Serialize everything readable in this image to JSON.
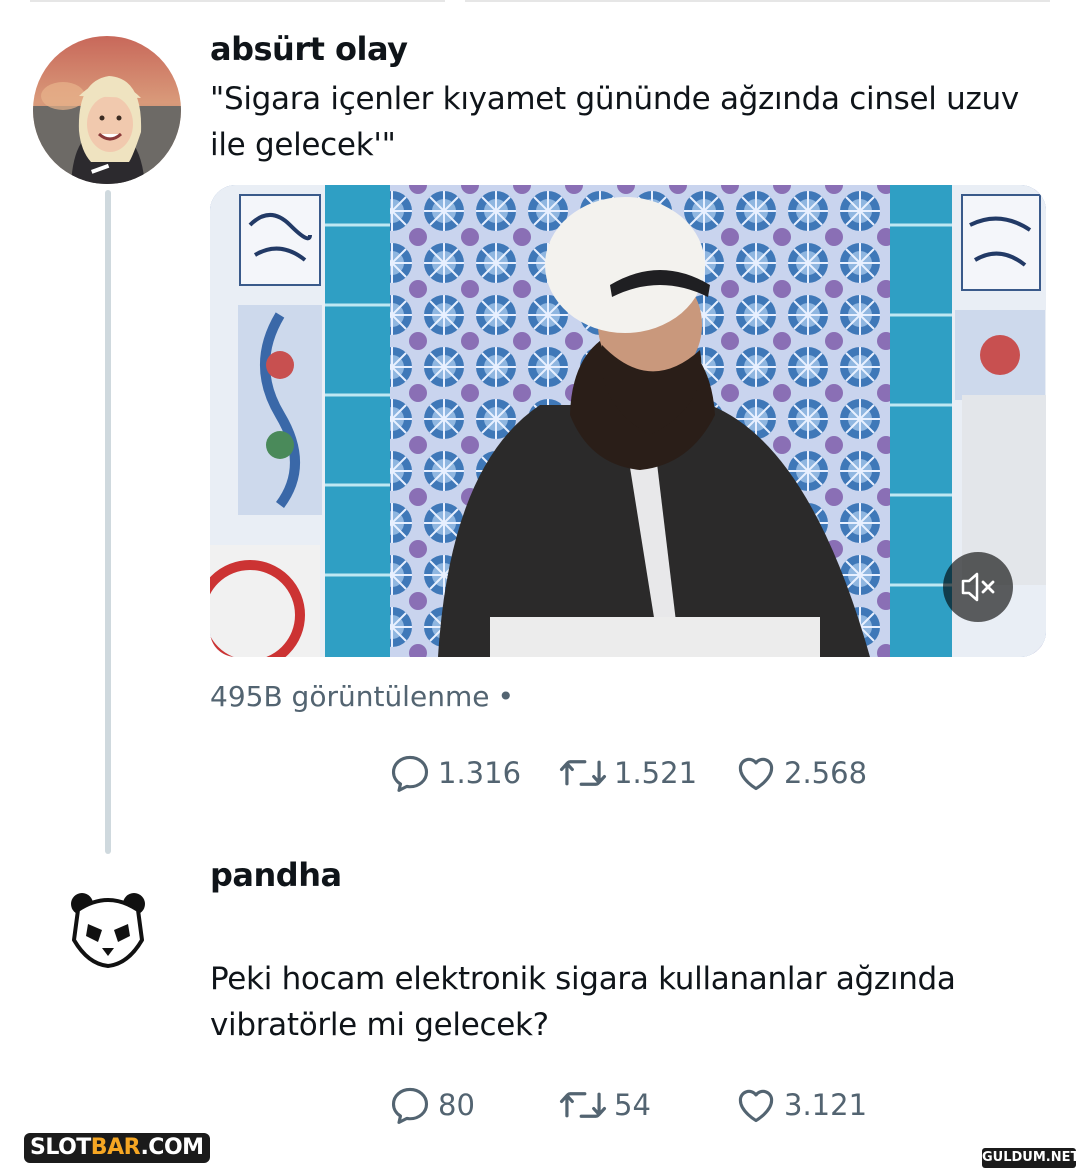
{
  "tweet1": {
    "author": "absürt olay",
    "text_line1": "\"Sigara içenler kıyamet gününde ağzında cinsel uzuv",
    "text_line2": "ile gelecek'\"",
    "views": "495B görüntülenme",
    "views_separator": "•",
    "replies": "1.316",
    "retweets": "1.521",
    "likes": "2.568"
  },
  "tweet2": {
    "author": "pandha",
    "text_line1": "Peki hocam elektronik sigara kullananlar ağzında",
    "text_line2": "vibratörle mi gelecek?",
    "replies": "80",
    "retweets": "54",
    "likes": "3.121"
  },
  "media": {
    "type": "video",
    "mute_icon": "speaker-muted-icon"
  },
  "watermarks": {
    "left_a": "SLOT",
    "left_b": "BAR",
    "left_c": ".COM",
    "right": "GULDUM.NET"
  },
  "icons": {
    "reply": "reply-bubble-icon",
    "retweet": "retweet-icon",
    "like": "heart-icon"
  },
  "colors": {
    "text_primary": "#0f1419",
    "text_secondary": "#536471",
    "thread_line": "#cfd9de",
    "tile_blue": "#2f9fc4"
  }
}
